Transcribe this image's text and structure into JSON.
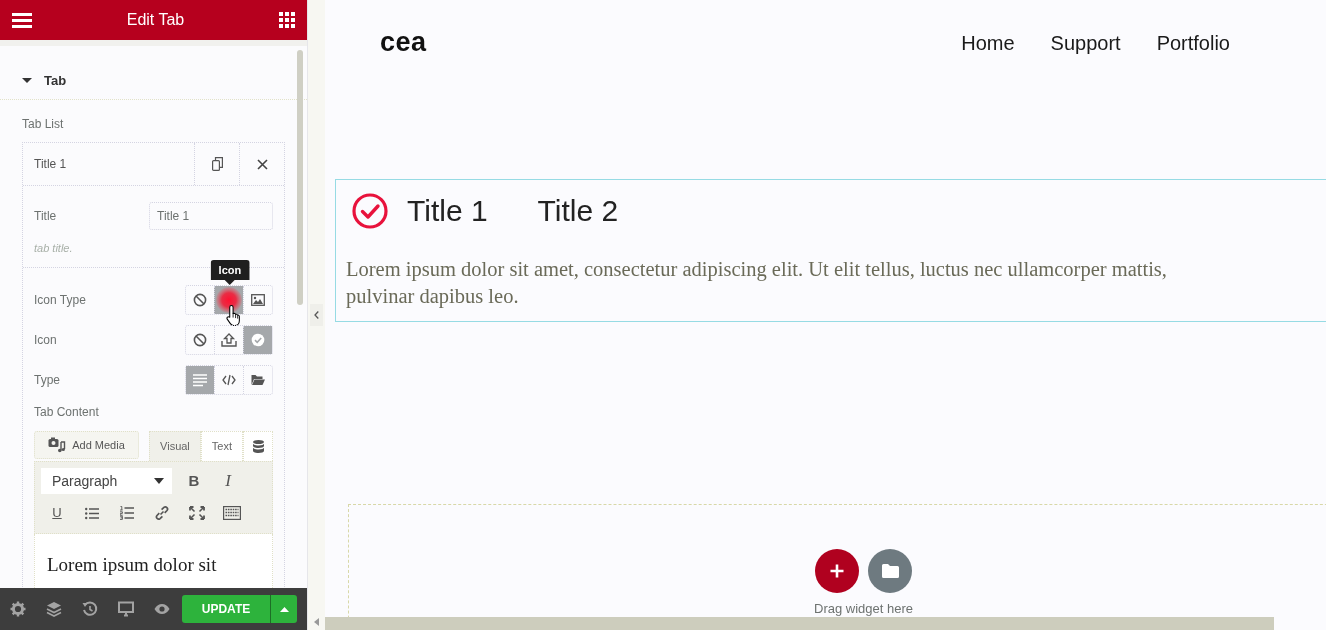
{
  "panel": {
    "title": "Edit Tab",
    "section": "Tab",
    "section_expanded": true
  },
  "tab_list": {
    "label": "Tab List",
    "item_title": "Title 1"
  },
  "title_field": {
    "label": "Title",
    "value": "Title 1",
    "description": "tab title."
  },
  "choice_rows": [
    {
      "label": "Icon Type",
      "tooltip": "Icon",
      "options": [
        {
          "selected": false
        },
        {
          "selected": true
        },
        {
          "selected": false
        }
      ]
    },
    {
      "label": "Icon",
      "options": [
        {
          "selected": false
        },
        {
          "selected": false
        },
        {
          "selected": true
        }
      ]
    },
    {
      "label": "Type",
      "options": [
        {
          "selected": true
        },
        {
          "selected": false
        },
        {
          "selected": false
        }
      ]
    }
  ],
  "tab_content": {
    "label": "Tab Content",
    "add_media": "Add Media",
    "editor_tabs": [
      {
        "label": "Visual",
        "selected": true
      },
      {
        "label": "Text",
        "selected": false
      }
    ],
    "format": "Paragraph",
    "bold": "B",
    "italic": "I",
    "underline": "U",
    "text": "Lorem ipsum dolor sit"
  },
  "footer": {
    "update": "UPDATE"
  },
  "site": {
    "logo": "cea",
    "nav": [
      "Home",
      "Support",
      "Portfolio"
    ]
  },
  "tabs_widget": {
    "tabs": [
      {
        "title": "Title 1",
        "icon": true
      },
      {
        "title": "Title 2",
        "icon": false
      }
    ],
    "content": "Lorem ipsum dolor sit amet, consectetur adipiscing elit. Ut elit tellus, luctus nec ullamcorper mattis, pulvinar dapibus leo."
  },
  "drop_zone": {
    "hint": "Drag widget here"
  }
}
